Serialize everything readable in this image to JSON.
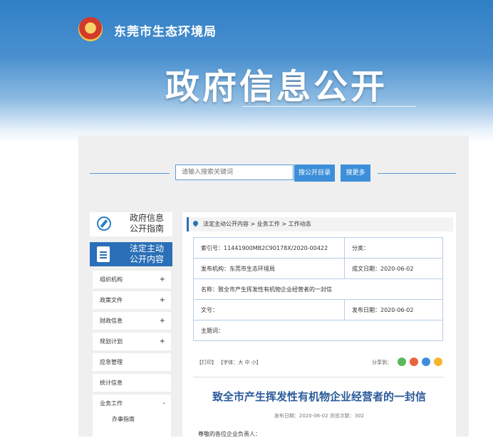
{
  "header": {
    "org_name": "东莞市生态环境局",
    "banner_title": "政府信息公开"
  },
  "search": {
    "placeholder": "请输入搜索关键词",
    "btn_catalog": "搜公开目录",
    "btn_more": "搜更多"
  },
  "sidebar": {
    "guide_line1": "政府信息",
    "guide_line2": "公开指南",
    "active_line1": "法定主动",
    "active_line2": "公开内容",
    "items": [
      {
        "label": "组织机构",
        "sign": "+"
      },
      {
        "label": "政策文件",
        "sign": "+"
      },
      {
        "label": "财政信息",
        "sign": "+"
      },
      {
        "label": "规划计划",
        "sign": "+"
      },
      {
        "label": "应急管理",
        "sign": ""
      },
      {
        "label": "统计信息",
        "sign": ""
      },
      {
        "label": "业务工作",
        "sign": "-"
      }
    ],
    "subitem": "办事指南"
  },
  "breadcrumb": {
    "text": "法定主动公开内容 > 业务工作 > 工作动态"
  },
  "info": {
    "index_no": "索引号：11441900MB2C90178X/2020-00422",
    "category": "分类：",
    "publisher": "发布机构：东莞市生态环境局",
    "created": "成文日期：2020-06-02",
    "name": "名称：致全市产生挥发性有机物企业经营者的一封信",
    "doc_no": "文号：",
    "published": "发布日期：2020-06-02",
    "subject": "主题词："
  },
  "tools": {
    "print": "【打印】",
    "font": "【字体：大 中 小】",
    "share": "分享到："
  },
  "article": {
    "title": "致全市产生挥发性有机物企业经营者的一封信",
    "meta": "发布日期：2020-06-02  浏览次数：302",
    "greeting": "尊敬的各位企业负责人："
  },
  "colors": {
    "accent": "#2a6fb8",
    "button": "#3d8fd9"
  }
}
